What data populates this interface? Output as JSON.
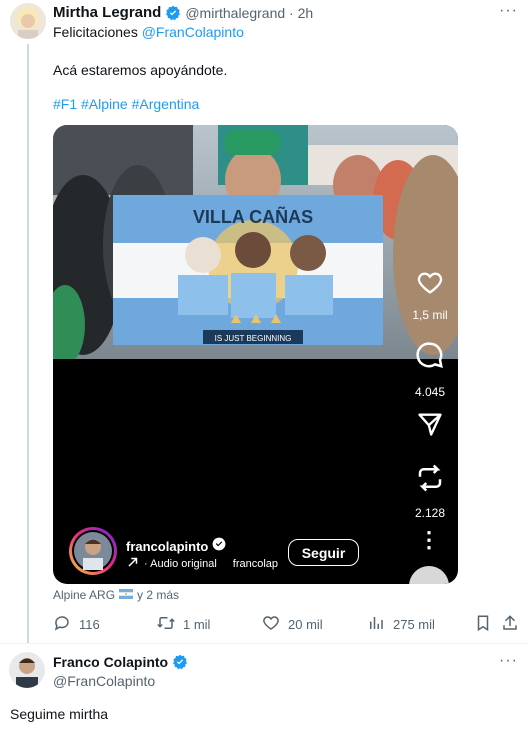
{
  "tweet1": {
    "author_name": "Mirtha Legrand",
    "handle_time": "@mirthalegrand · 2h",
    "reply_prefix": "Felicitaciones",
    "reply_mention": "@FranColapinto",
    "body": "Acá estaremos apoyándote.",
    "hashtags": "#F1 #Alpine #Argentina",
    "more": "···"
  },
  "video": {
    "banner_text": "IS JUST BEGINNING",
    "flag_top_text": "VILLA CAÑAS",
    "likes": "1,5 mil",
    "comments": "4.045",
    "reposts": "2.128",
    "username": "francolapinto",
    "audio": "· Audio original",
    "audio_scroll": "francolap",
    "follow": "Seguir",
    "more": "⋮"
  },
  "source": {
    "label": "Alpine ARG",
    "time": "y 2 más"
  },
  "actions": {
    "replies": "116",
    "reposts": "1 mil",
    "likes": "20 mil",
    "views": "275 mil"
  },
  "tweet2": {
    "author_name": "Franco Colapinto",
    "handle": "@FranColapinto",
    "body": "Seguime mirtha",
    "more": "···"
  },
  "colors": {
    "accent": "#1d9bf0",
    "muted": "#536471",
    "verified": "#1d9bf0"
  }
}
